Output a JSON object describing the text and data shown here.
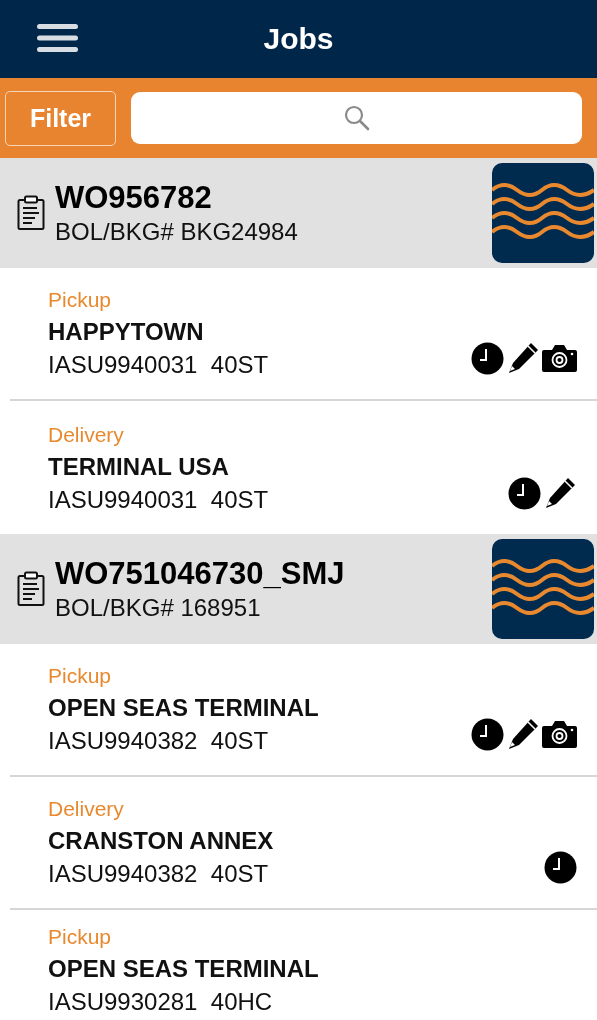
{
  "header": {
    "title": "Jobs"
  },
  "filter_bar": {
    "button": "Filter"
  },
  "jobs": [
    {
      "order": "WO956782",
      "booking": "BOL/BKG# BKG24984",
      "stops": [
        {
          "type": "Pickup",
          "location": "HAPPYTOWN",
          "container": "IASU9940031  40ST",
          "clock": true,
          "edit": true,
          "camera": true
        },
        {
          "type": "Delivery",
          "location": "TERMINAL USA",
          "container": "IASU9940031  40ST",
          "clock": true,
          "edit": true,
          "camera": false
        }
      ]
    },
    {
      "order": "WO751046730_SMJ",
      "booking": "BOL/BKG# 168951",
      "stops": [
        {
          "type": "Pickup",
          "location": "OPEN SEAS TERMINAL",
          "container": "IASU9940382  40ST",
          "clock": true,
          "edit": true,
          "camera": true
        },
        {
          "type": "Delivery",
          "location": "CRANSTON ANNEX",
          "container": "IASU9940382  40ST",
          "clock": true,
          "edit": false,
          "camera": false
        },
        {
          "type": "Pickup",
          "location": "OPEN SEAS TERMINAL",
          "container": "IASU9930281  40HC",
          "clock": false,
          "edit": false,
          "camera": false
        }
      ]
    }
  ]
}
